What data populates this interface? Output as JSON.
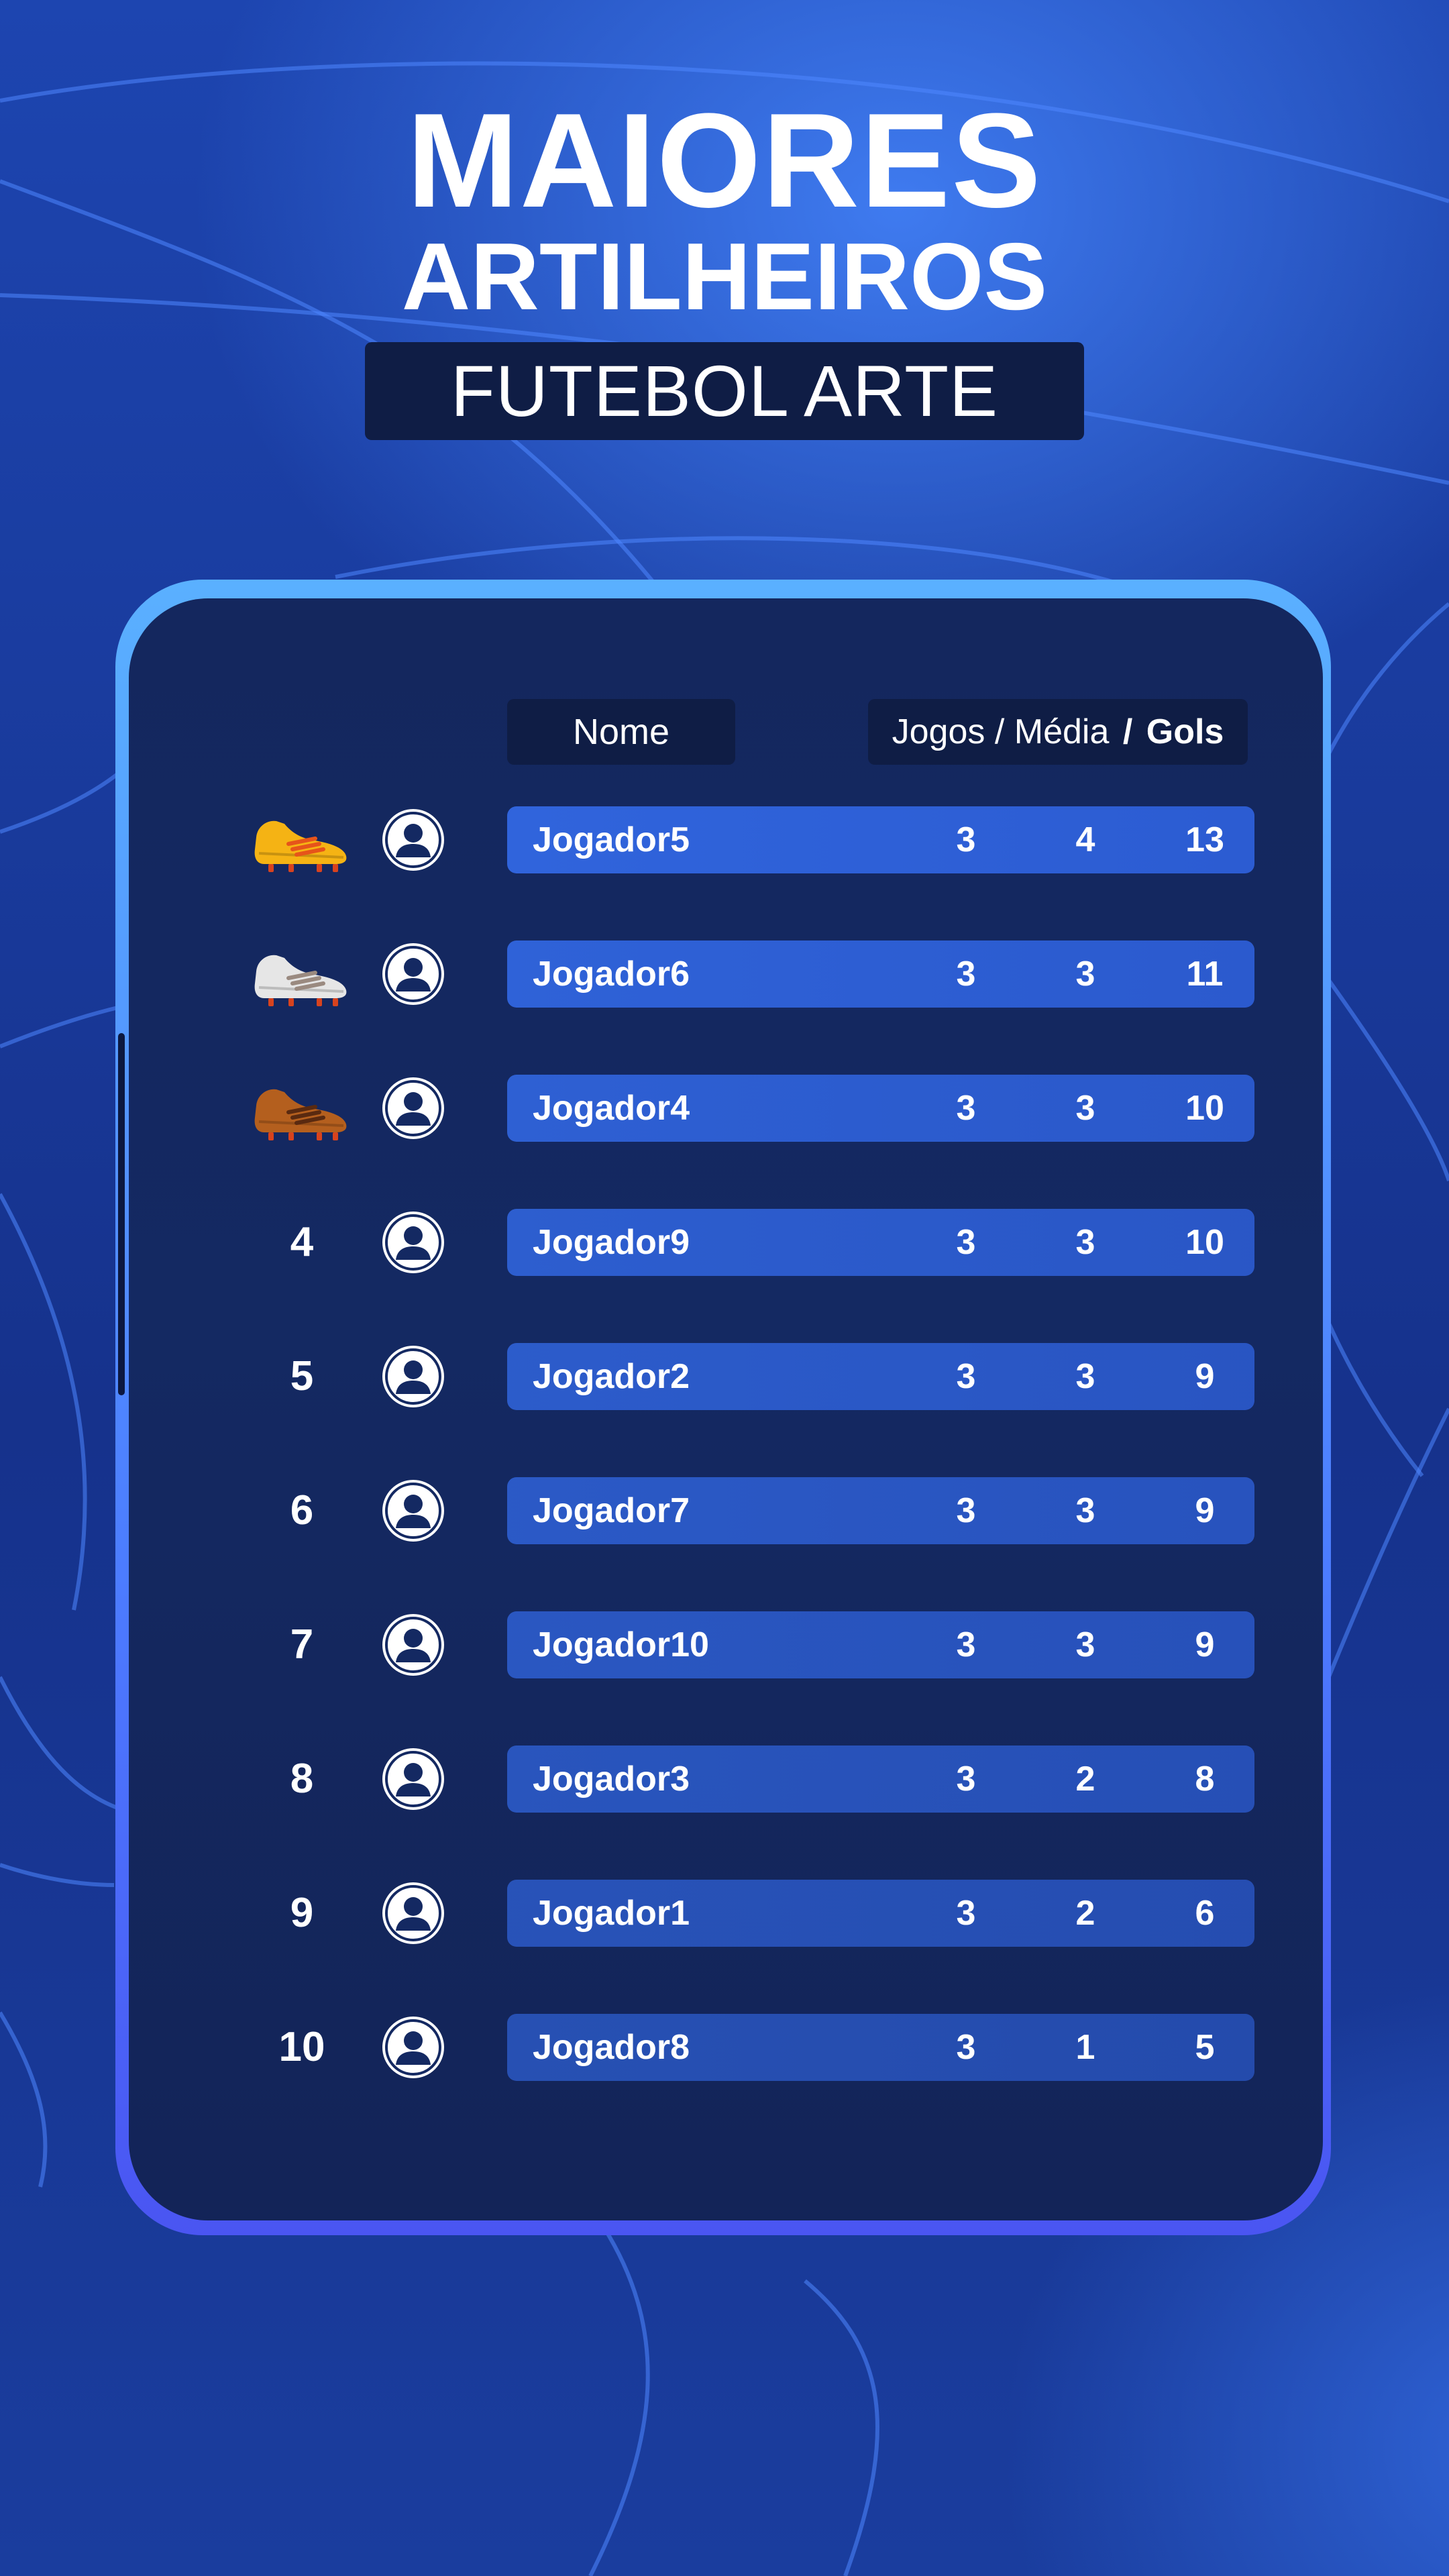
{
  "header": {
    "title_line1": "MAIORES",
    "title_line2": "ARTILHEIROS",
    "subtitle": "FUTEBOL ARTE"
  },
  "table": {
    "col_name": "Nome",
    "col_jogos": "Jogos",
    "col_sep1": "/",
    "col_media": "Média",
    "col_sep2": "/",
    "col_gols": "Gols",
    "rows": [
      {
        "rank": "",
        "award": "gold-boot-icon",
        "name": "Jogador5",
        "jogos": "3",
        "media": "4",
        "gols": "13"
      },
      {
        "rank": "",
        "award": "silver-boot-icon",
        "name": "Jogador6",
        "jogos": "3",
        "media": "3",
        "gols": "11"
      },
      {
        "rank": "",
        "award": "bronze-boot-icon",
        "name": "Jogador4",
        "jogos": "3",
        "media": "3",
        "gols": "10"
      },
      {
        "rank": "4",
        "award": "",
        "name": "Jogador9",
        "jogos": "3",
        "media": "3",
        "gols": "10"
      },
      {
        "rank": "5",
        "award": "",
        "name": "Jogador2",
        "jogos": "3",
        "media": "3",
        "gols": "9"
      },
      {
        "rank": "6",
        "award": "",
        "name": "Jogador7",
        "jogos": "3",
        "media": "3",
        "gols": "9"
      },
      {
        "rank": "7",
        "award": "",
        "name": "Jogador10",
        "jogos": "3",
        "media": "3",
        "gols": "9"
      },
      {
        "rank": "8",
        "award": "",
        "name": "Jogador3",
        "jogos": "3",
        "media": "2",
        "gols": "8"
      },
      {
        "rank": "9",
        "award": "",
        "name": "Jogador1",
        "jogos": "3",
        "media": "2",
        "gols": "6"
      },
      {
        "rank": "10",
        "award": "",
        "name": "Jogador8",
        "jogos": "3",
        "media": "1",
        "gols": "5"
      }
    ]
  },
  "colors": {
    "gold": "#f5b314",
    "silver": "#e6e6e6",
    "bronze": "#b45f1e",
    "bar_start": "#2f62d9",
    "bar_end": "#2a5bd0"
  }
}
